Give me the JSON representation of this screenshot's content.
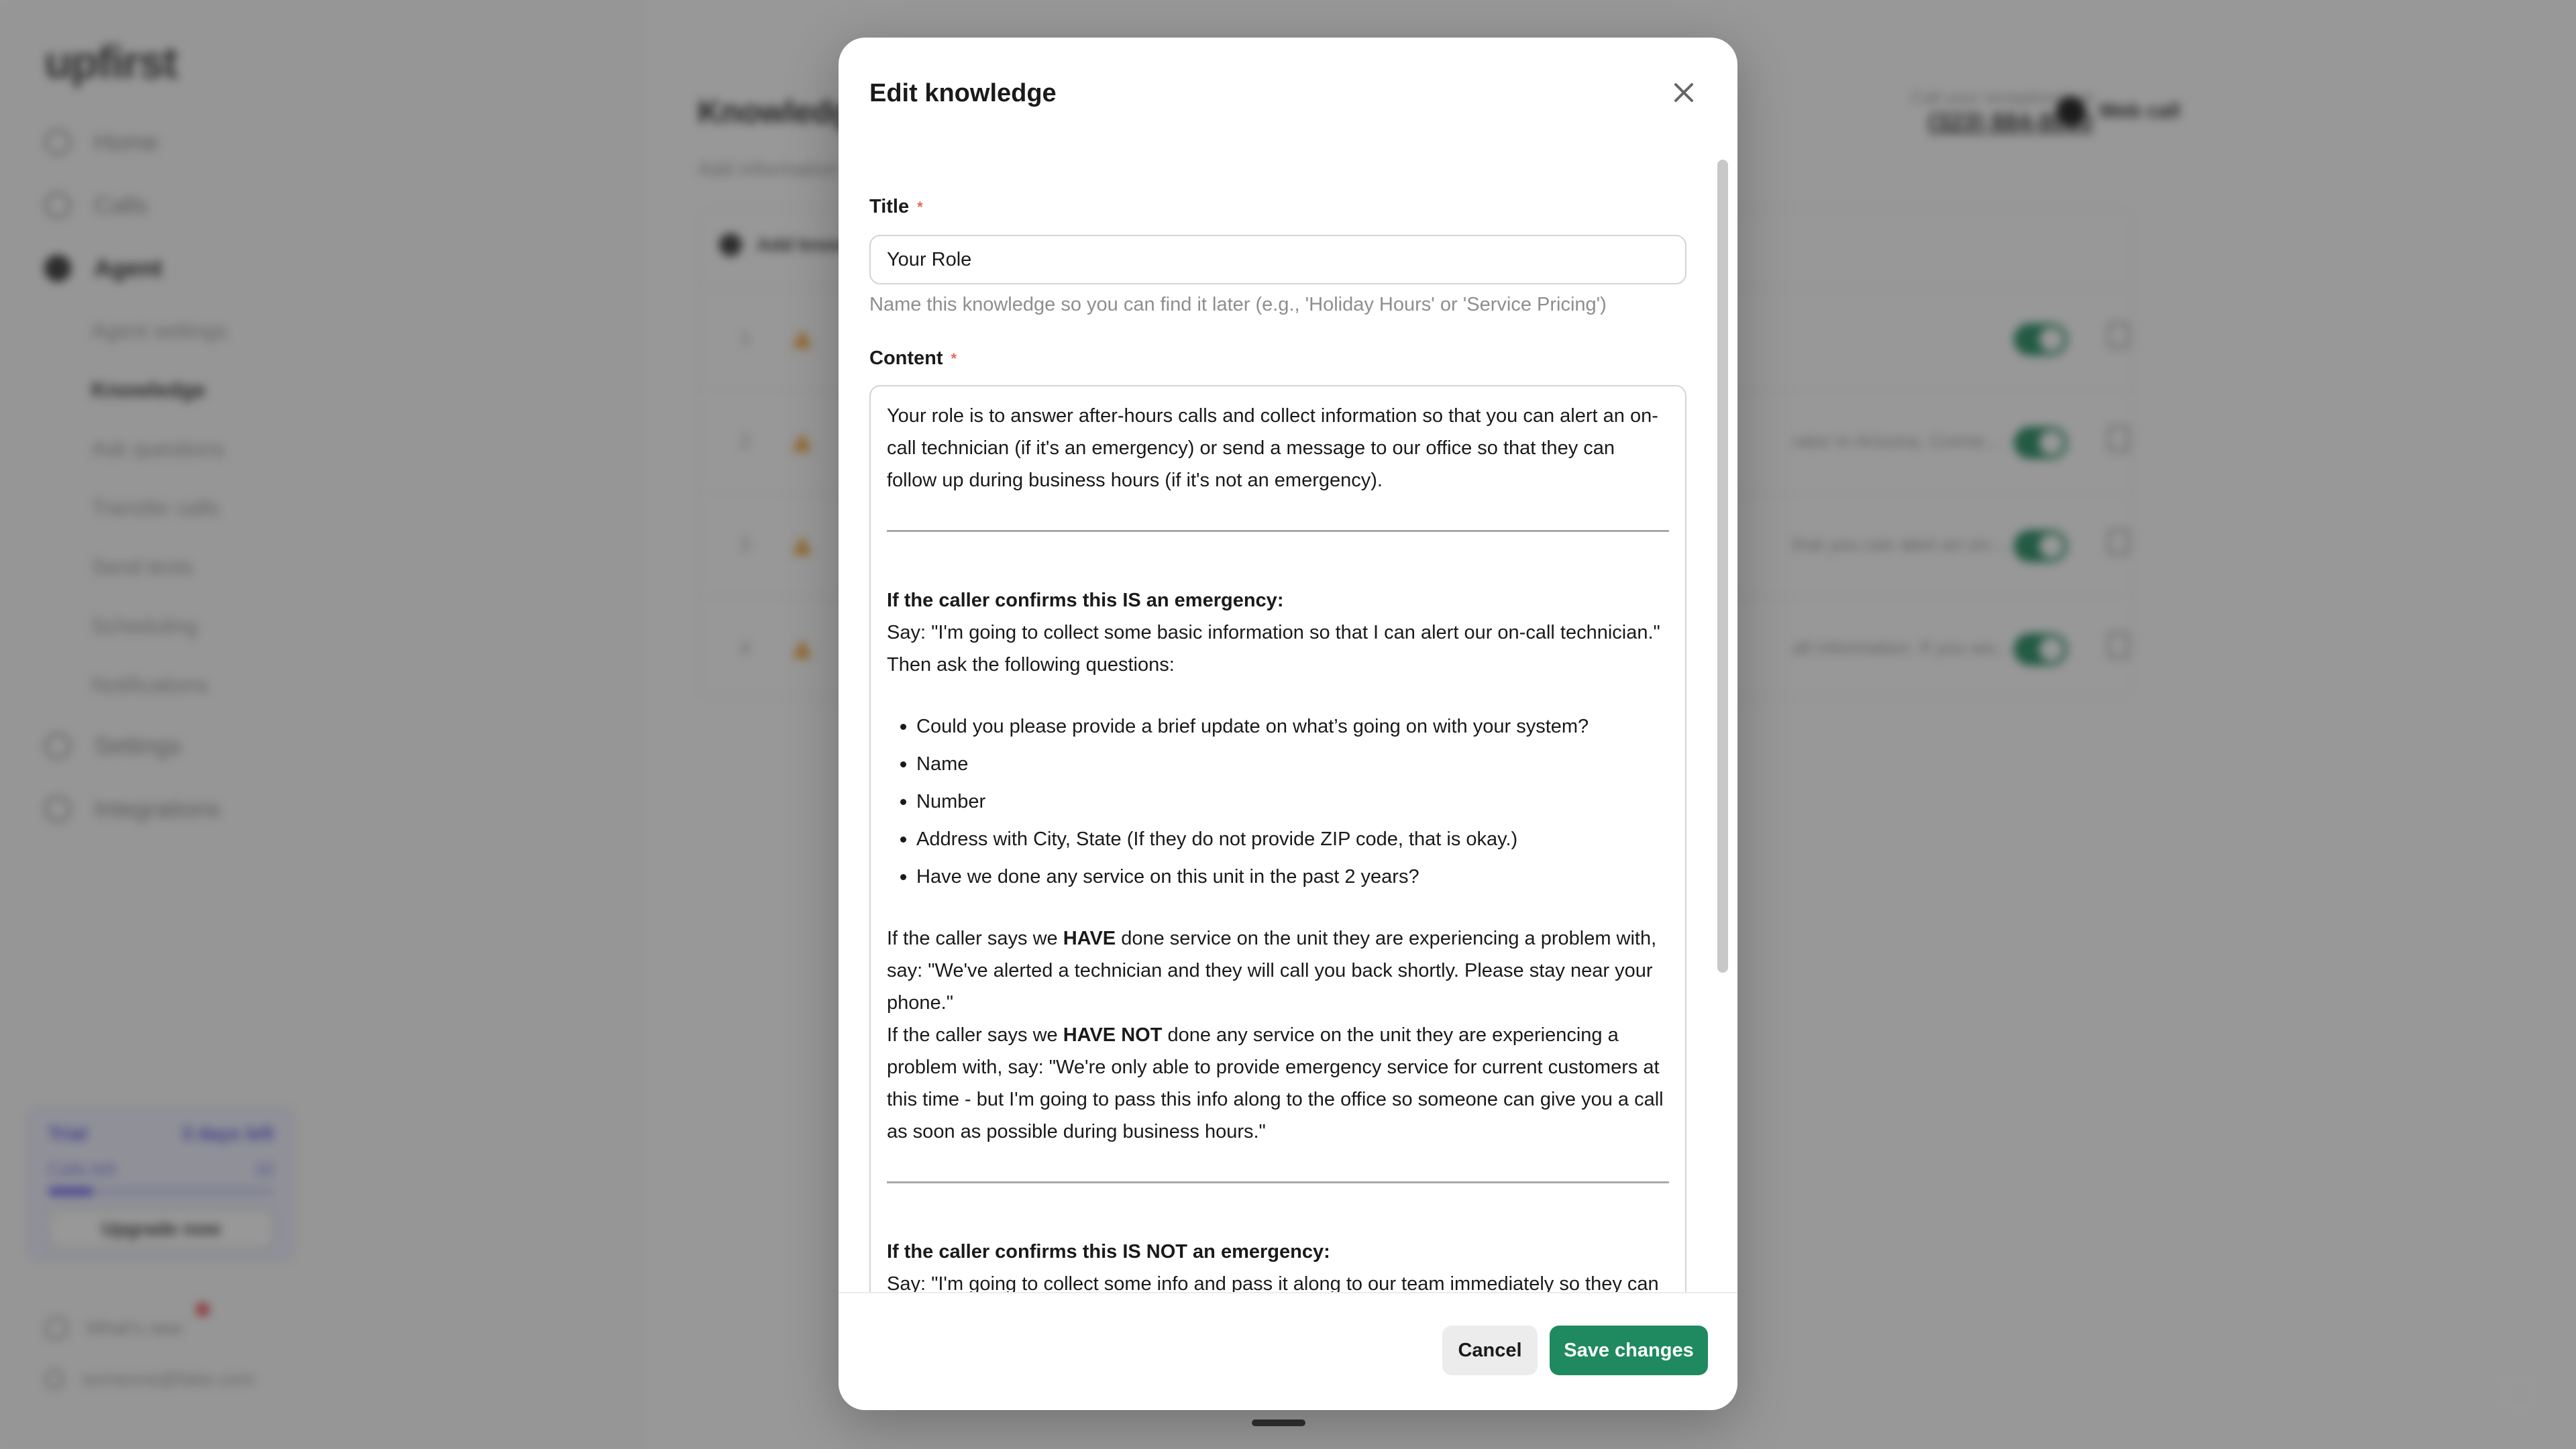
{
  "app": {
    "logo": "upfirst",
    "nav": [
      {
        "label": "Home",
        "icon": "home-icon"
      },
      {
        "label": "Calls",
        "icon": "phone-icon"
      },
      {
        "label": "Agent",
        "icon": "agent-icon"
      },
      {
        "label": "Settings",
        "icon": "gear-icon"
      },
      {
        "label": "Integrations",
        "icon": "puzzle-icon"
      }
    ],
    "agent_sub": [
      "Agent settings",
      "Knowledge",
      "Ask questions",
      "Transfer calls",
      "Send texts",
      "Scheduling",
      "Notifications"
    ],
    "trial": {
      "label": "Trial",
      "days": "3 days left",
      "calls_label": "Calls left",
      "calls": "10",
      "progress": 0.2,
      "upgrade": "Upgrade now"
    },
    "whats_new": "What's new",
    "user": "someone@fake.com",
    "page_title": "Knowledge",
    "page_subtitle": "Add information",
    "phone_label": "Call your receptionist at",
    "phone_number": "(323) 884-8000",
    "web_call": "Web call",
    "add_knowledge": "Add knowledge",
    "rows": [
      {
        "num": "1",
        "snippet": ""
      },
      {
        "num": "2",
        "snippet": "rator in Arizona, Conne..."
      },
      {
        "num": "3",
        "snippet": "that you can alert an on-..."
      },
      {
        "num": "4",
        "snippet": "all information. If you wo..."
      }
    ]
  },
  "modal": {
    "title": "Edit knowledge",
    "title_field": {
      "label": "Title",
      "value": "Your Role",
      "helper": "Name this knowledge so you can find it later (e.g., 'Holiday Hours' or 'Service Pricing')"
    },
    "content_field": {
      "label": "Content",
      "intro": "Your role is to answer after-hours calls and collect information so that you can alert an on-call technician (if it's an emergency) or send a message to our office so that they can follow up during business hours (if it's not an emergency).",
      "emergency_heading": "If the caller confirms this IS an emergency:",
      "emergency_say": "Say: \"I'm going to collect some basic information so that I can alert our on-call technician.\"",
      "emergency_then": "Then ask the following questions:",
      "questions": [
        "Could you please provide a brief update on what’s going on with your system?",
        "Name",
        "Number",
        "Address with City, State (If they do not provide ZIP code, that is okay.)",
        "Have we done any service on this unit in the past 2 years?"
      ],
      "have_pre": "If the caller says we ",
      "have_bold": "HAVE",
      "have_post": " done service on the unit they are experiencing a problem with, say: \"We've alerted a technician and they will call you back shortly. Please stay near your phone.\"",
      "havenot_pre": "If the caller says we ",
      "havenot_bold": "HAVE NOT",
      "havenot_post": " done any service on the unit they are experiencing a problem with, say: \"We're only able to provide emergency service for current customers at this time - but I'm going to pass this info along to the office so someone can give you a call as soon as possible during business hours.\"",
      "nonemergency_heading": "If the caller confirms this IS NOT an emergency:",
      "nonemergency_say": "Say: \"I'm going to collect some info and pass it along to our team immediately so they can get back to you during normal business hours.\""
    },
    "cancel_label": "Cancel",
    "save_label": "Save changes"
  },
  "colors": {
    "primary_green": "#1f8a5f",
    "required_star": "#e8685e",
    "overlay": "rgba(40,40,40,0.48)"
  }
}
